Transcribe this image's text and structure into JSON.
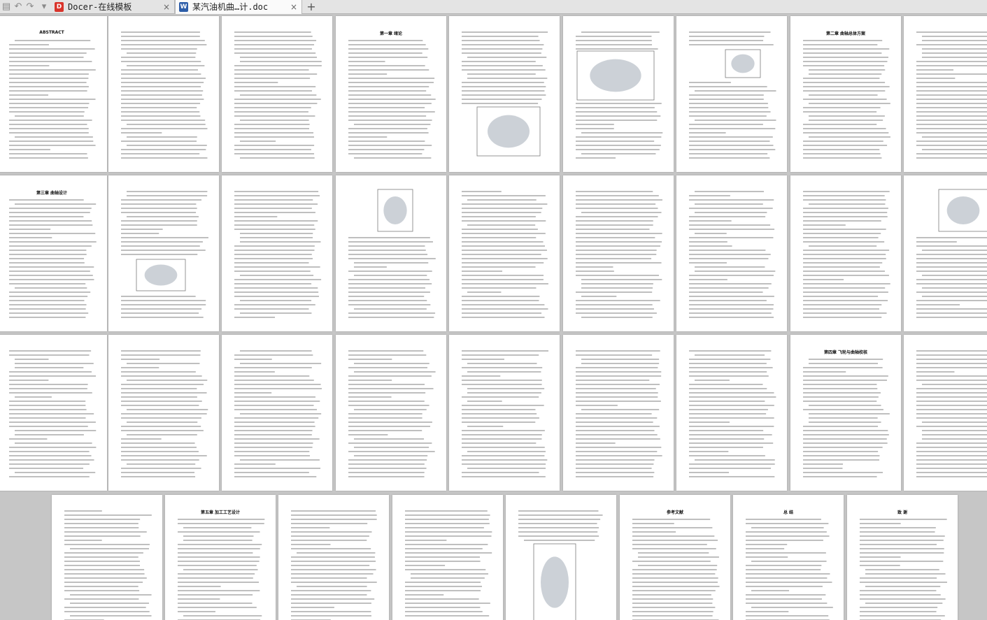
{
  "tabbar": {
    "tabs": [
      {
        "label": "Docer-在线模板",
        "icon": "docer-icon",
        "icon_color": "#d9342b",
        "active": false
      },
      {
        "label": "某汽油机曲…计.doc",
        "icon": "wps-writer-icon",
        "icon_color": "#2d5da8",
        "active": true
      }
    ],
    "new_tab": "+",
    "close_glyph": "×"
  },
  "document": {
    "abstract_heading": "ABSTRACT",
    "ch1_title": "第一章 绪论",
    "ch2_title": "第二章 曲轴总体方案",
    "ch3_title": "第三章 曲轴设计",
    "ch4_title": "第四章 飞轮与曲轴校核",
    "ch5_title": "第五章 加工工艺设计",
    "references_title": "参考文献",
    "conclusion_title": "总 结",
    "thanks_title": "致 谢"
  },
  "colors": {
    "workspace": "#c6c6c6",
    "page": "#ffffff",
    "text_lines": "#8a8a8a",
    "accent": "#3a8a3a"
  }
}
